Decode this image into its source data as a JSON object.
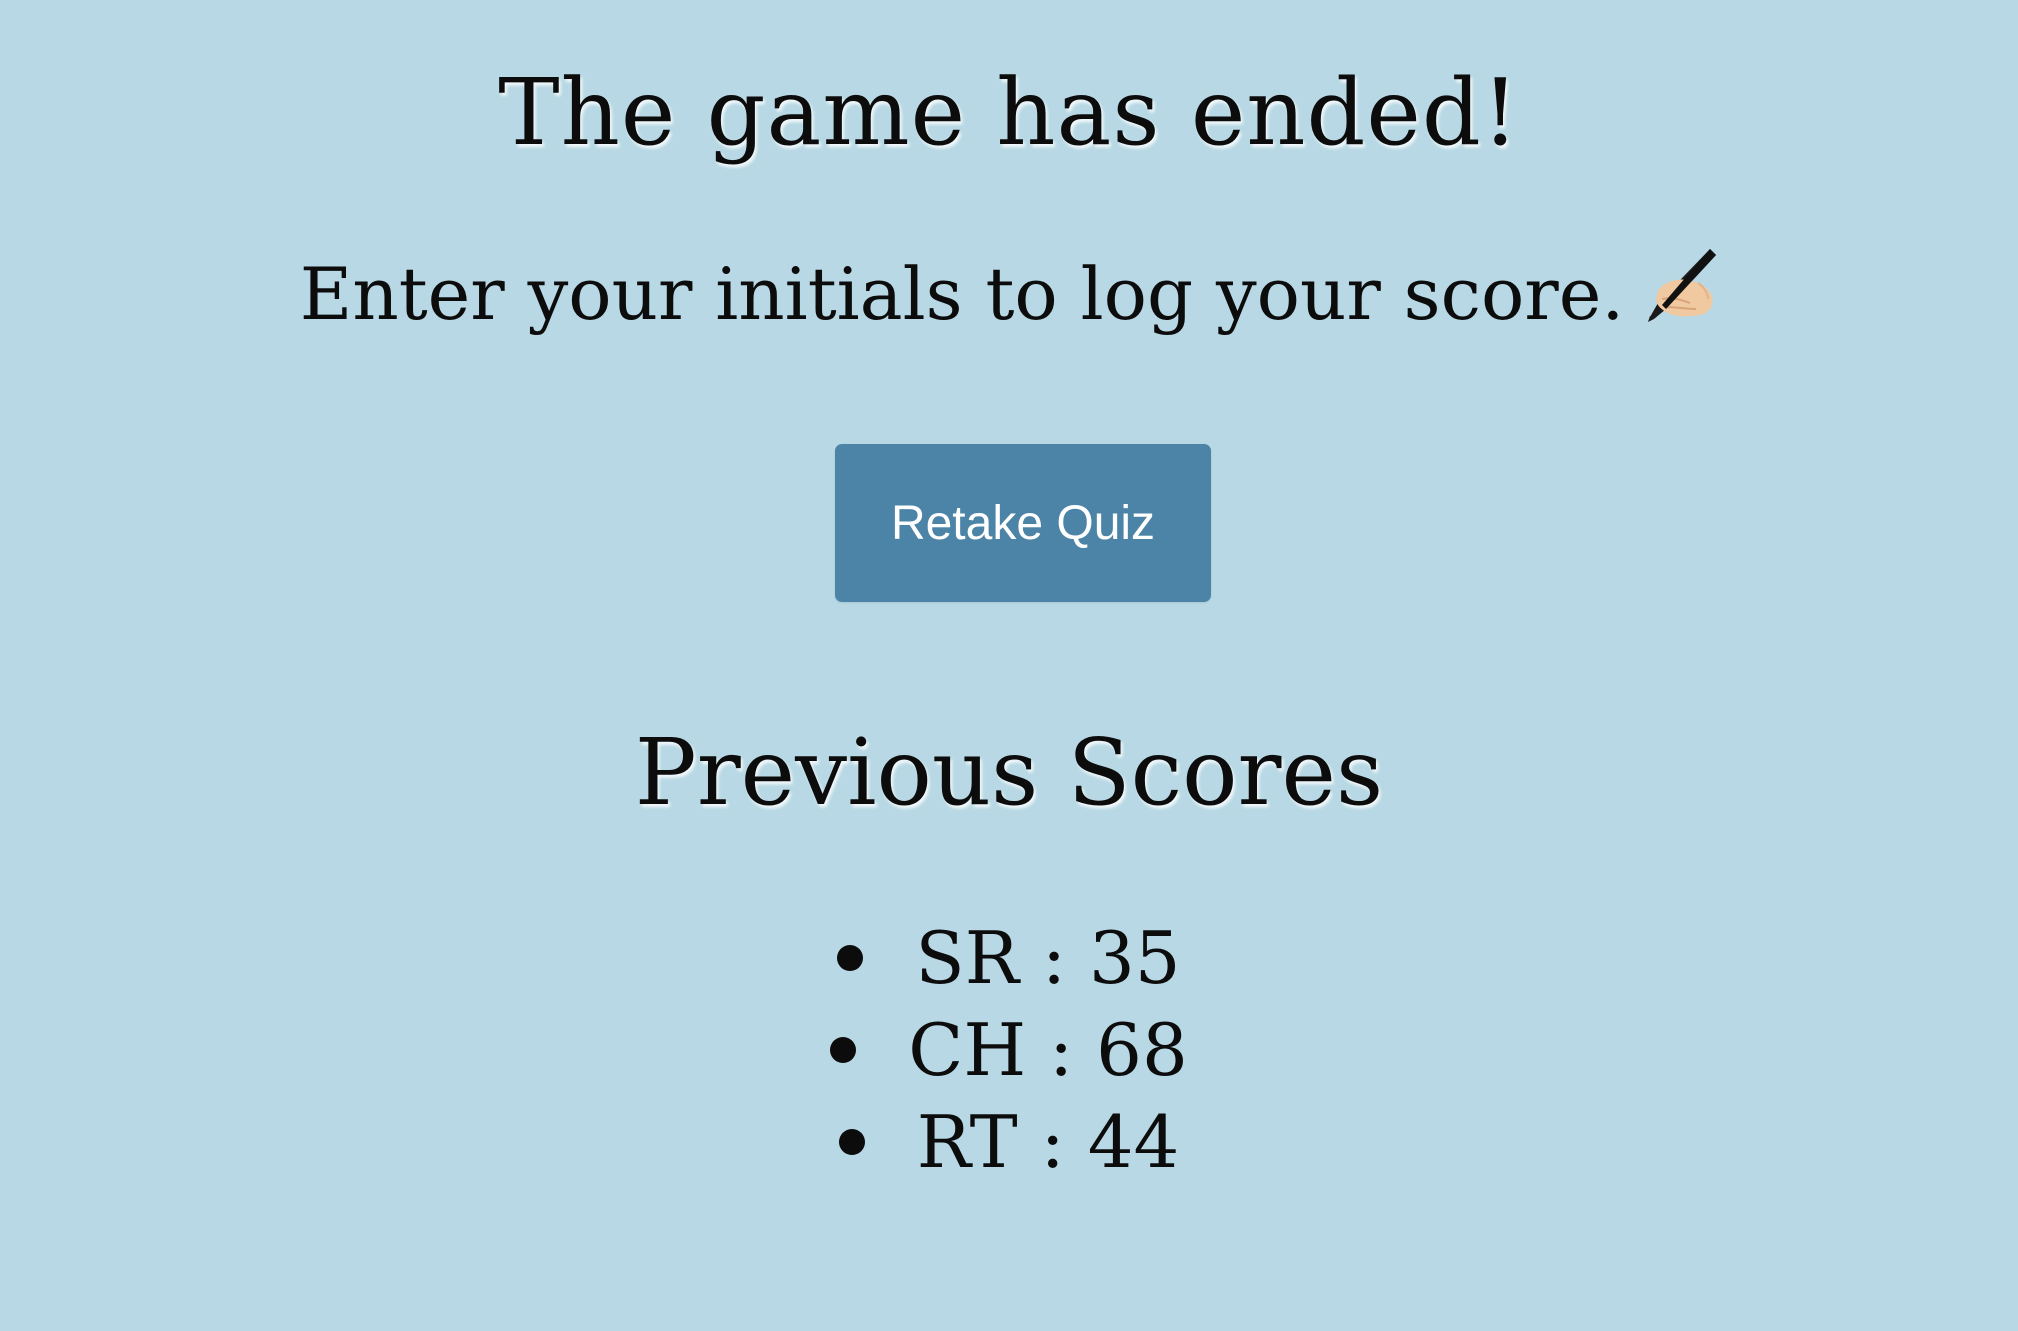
{
  "header": {
    "title": "The game has ended!",
    "subtitle": "Enter your initials to log your score.",
    "subtitle_icon": "writing-hand-icon"
  },
  "actions": {
    "retake_label": "Retake Quiz"
  },
  "scores": {
    "heading": "Previous Scores",
    "items": [
      {
        "text": "SR : 35",
        "initials": "SR",
        "score": 35
      },
      {
        "text": "CH : 68",
        "initials": "CH",
        "score": 68
      },
      {
        "text": "RT : 44",
        "initials": "RT",
        "score": 44
      }
    ]
  },
  "colors": {
    "background": "#b7d8e4",
    "button": "#4b84a6",
    "button_text": "#ffffff",
    "text": "#0c0c0c"
  }
}
